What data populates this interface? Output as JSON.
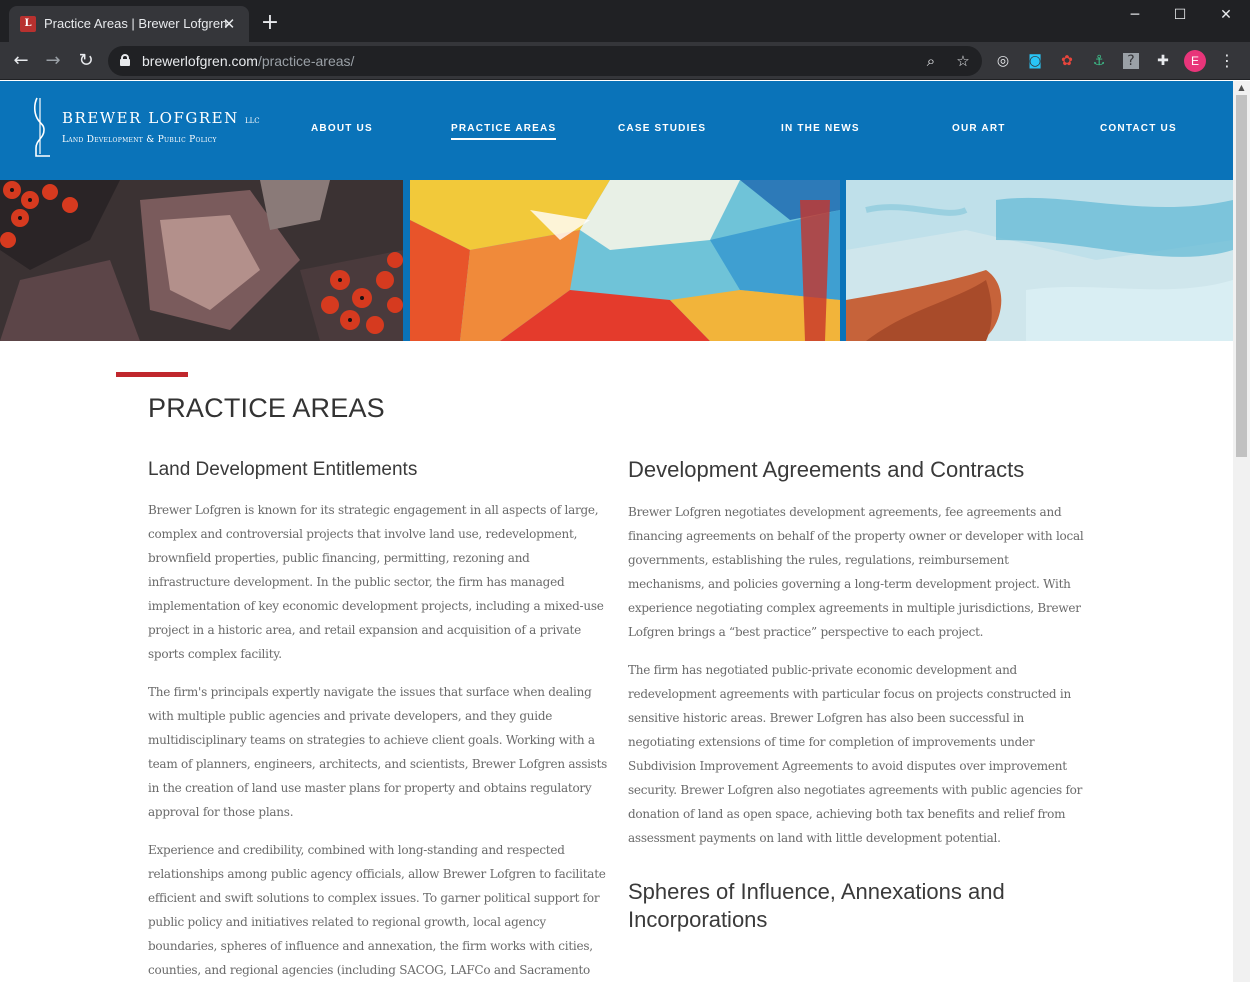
{
  "browser": {
    "tab_title": "Practice Areas | Brewer Lofgren",
    "favicon_letter": "L",
    "close_glyph": "✕",
    "new_tab_glyph": "+",
    "win_minimize": "─",
    "win_maximize": "☐",
    "win_close": "✕",
    "back_glyph": "←",
    "forward_glyph": "→",
    "reload_glyph": "↻",
    "url_domain": "brewerlofgren.com",
    "url_path": "/practice-areas/",
    "zoom_glyph": "⌕",
    "star_glyph": "☆",
    "extensions": [
      "◎",
      "◙",
      "✿",
      "⚓",
      "?",
      "✚"
    ],
    "more_glyph": "⋮",
    "avatar_letter": "E",
    "scroll_up_glyph": "▲"
  },
  "site": {
    "logo_name": "BREWER LOFGREN",
    "logo_llc": "LLC",
    "logo_subtitle": "Land Development & Public Policy",
    "nav": [
      {
        "label": "About Us"
      },
      {
        "label": "Practice Areas"
      },
      {
        "label": "Case Studies"
      },
      {
        "label": "In the News"
      },
      {
        "label": "Our Art"
      },
      {
        "label": "Contact Us"
      }
    ],
    "active_nav": "Practice Areas"
  },
  "page": {
    "title": "PRACTICE AREAS",
    "left": {
      "heading": "Land Development Entitlements",
      "paragraphs": [
        "Brewer Lofgren is known for its strategic engagement in all aspects of large, complex and controversial projects that involve land use, redevelopment, brownfield properties, public financing, permitting, rezoning and infrastructure development. In the public sector, the firm has managed implementation of key economic development projects, including a mixed-use project in a historic area, and retail expansion and acquisition of a private sports complex facility.",
        "The firm's principals expertly navigate the issues that surface when dealing with multiple public agencies and private developers, and they guide multidisciplinary teams on strategies to achieve client goals. Working with a team of planners, engineers, architects, and scientists, Brewer Lofgren assists in the creation of land use master plans for property and obtains regulatory approval for those plans.",
        "Experience and credibility, combined with long-standing and respected relationships among public agency officials, allow Brewer Lofgren to facilitate efficient and swift solutions to complex issues. To garner political support for public policy and initiatives related to regional growth, local agency boundaries, spheres of influence and annexation, the firm works with cities, counties, and regional agencies (including SACOG, LAFCo and Sacramento Air Quality Management District) on behalf of private clients. The firm also engages stakeholder groups to identify areas"
      ]
    },
    "right": {
      "heading1": "Development Agreements and Contracts",
      "paragraphs1": [
        "Brewer Lofgren negotiates development agreements, fee agreements and financing agreements on behalf of the property owner or developer with local governments, establishing the rules, regulations, reimbursement mechanisms, and policies governing a long-term development project. With experience negotiating complex agreements in multiple jurisdictions, Brewer Lofgren brings a “best practice” perspective to each project.",
        "The firm has negotiated public-private economic development and redevelopment agreements with particular focus on projects constructed in sensitive historic areas. Brewer Lofgren has also been successful in negotiating extensions of time for completion of improvements under Subdivision Improvement Agreements to avoid disputes over improvement security.  Brewer Lofgren also negotiates agreements with public agencies for donation of land as open space, achieving both tax benefits and relief from assessment payments on land with little development potential."
      ],
      "heading2": "Spheres of Influence, Annexations and Incorporations"
    }
  },
  "colors": {
    "header_blue": "#0a73b9",
    "accent_red": "#c0272d",
    "body_text": "#6a6a6a",
    "heading_text": "#333333"
  }
}
